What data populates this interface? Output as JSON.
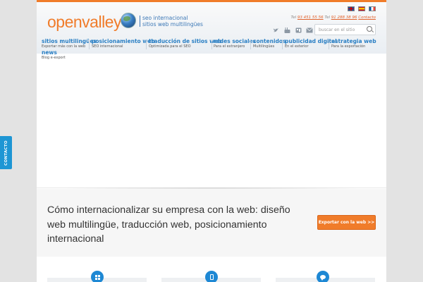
{
  "header": {
    "logo": "openvalley",
    "tagline_line1": "seo internacional",
    "tagline_line2": "sitios web multilingües",
    "contact": {
      "tel1_prefix": "Tel",
      "tel1": "93 451 55 56",
      "tel2_prefix": "Tel",
      "tel2": "91 288 38 96",
      "contact_label": "Contacto"
    },
    "languages": [
      "English",
      "Español",
      "Français"
    ],
    "social_icons": [
      "twitter-icon",
      "youtube-icon",
      "rss-icon",
      "mail-icon"
    ],
    "search": {
      "placeholder": "buscar en el sitio",
      "value": ""
    }
  },
  "nav": {
    "items": [
      {
        "label": "sitios multilingües",
        "sub": "Exportar más con la web"
      },
      {
        "label": "posicionamiento web",
        "sub": "SEO internacional"
      },
      {
        "label": "traducción de sitios web",
        "sub": "Optimizada para el SEO"
      },
      {
        "label": "redes sociales",
        "sub": "Para el extranjero"
      },
      {
        "label": "contenidos",
        "sub": "Multilingües"
      },
      {
        "label": "publicidad digital",
        "sub": "En el exterior"
      },
      {
        "label": "estrategia web",
        "sub": "Para la exportación"
      },
      {
        "label": "news",
        "sub": "Blog e-export"
      }
    ]
  },
  "intro": {
    "title": "Cómo internacionalizar su empresa con la web: diseño web multilingüe, traducción web, posicionamiento internacional",
    "cta_label": "Exportar con la web >>"
  },
  "features": {
    "icons": [
      "grid-icon",
      "phone-icon",
      "chat-icon"
    ]
  },
  "side_tab": {
    "label": "CONTACTO"
  },
  "colors": {
    "brand_orange": "#f07c2a",
    "link_blue": "#2a7fc4",
    "side_tab_blue": "#1e96d4"
  }
}
